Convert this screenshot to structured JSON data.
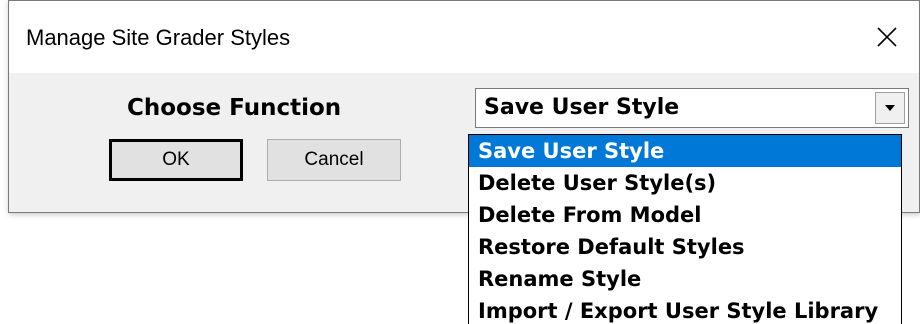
{
  "window": {
    "title": "Manage Site Grader Styles"
  },
  "form": {
    "choose_label": "Choose Function",
    "combo_value": "Save User Style"
  },
  "buttons": {
    "ok_label": "OK",
    "cancel_label": "Cancel"
  },
  "dropdown": {
    "items": [
      {
        "label": "Save User Style",
        "selected": true
      },
      {
        "label": "Delete User Style(s)",
        "selected": false
      },
      {
        "label": "Delete From Model",
        "selected": false
      },
      {
        "label": "Restore Default Styles",
        "selected": false
      },
      {
        "label": "Rename Style",
        "selected": false
      },
      {
        "label": "Import / Export User Style Library",
        "selected": false
      }
    ]
  },
  "icons": {
    "close": "close-icon",
    "dropdown_arrow": "triangle-down-icon"
  },
  "colors": {
    "selection": "#0078d7",
    "dialog_bg": "#f0f0f0"
  }
}
